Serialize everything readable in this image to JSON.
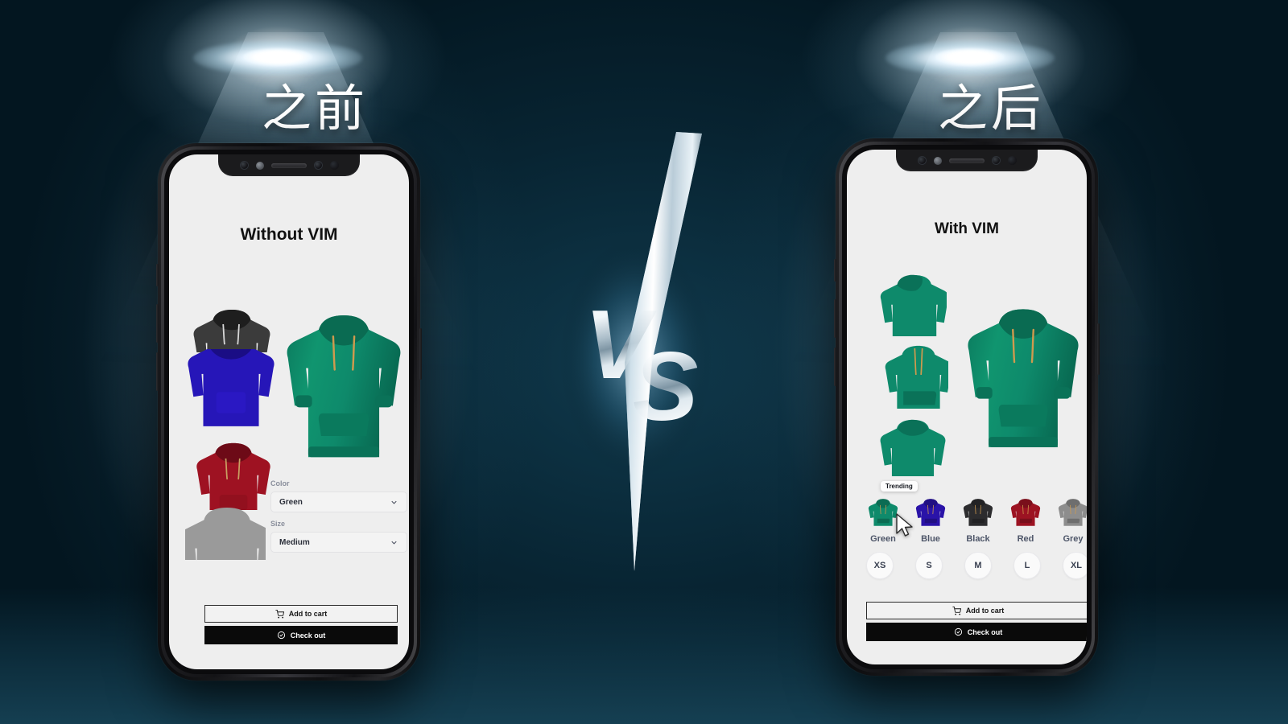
{
  "background": {
    "base_color": "#05202c",
    "accent_color": "#0f8f6d"
  },
  "comparison": {
    "left_label": "之前",
    "right_label": "之后",
    "divider_text": "VS"
  },
  "left_phone": {
    "app_title": "Without VIM",
    "color_field": {
      "label": "Color",
      "value": "Green",
      "chevron": "chevron-down-icon"
    },
    "size_field": {
      "label": "Size",
      "value": "Medium",
      "chevron": "chevron-down-icon"
    },
    "add_to_cart": {
      "label": "Add to cart",
      "icon": "shopping-cart-icon"
    },
    "check_out": {
      "label": "Check out",
      "icon": "check-circle-icon"
    },
    "thumbnails": [
      {
        "name": "black-hoodie-thumbnail",
        "color": "#3b3b3b"
      },
      {
        "name": "blue-hoodie-thumbnail",
        "color": "#2616b8"
      },
      {
        "name": "red-hoodie-thumbnail",
        "color": "#9e1222"
      },
      {
        "name": "grey-hoodie-thumbnail",
        "color": "#9a9a9a"
      }
    ],
    "hero": {
      "name": "green-hoodie-hero",
      "color": "#0e8a6b"
    }
  },
  "right_phone": {
    "app_title": "With VIM",
    "badge": "Trending",
    "cursor": "mouse-pointer-icon",
    "thumbnails": [
      {
        "name": "green-hoodie-back-thumbnail",
        "color": "#0e8a6b"
      },
      {
        "name": "green-hoodie-side-thumbnail",
        "color": "#0e8a6b"
      },
      {
        "name": "green-hoodie-front-thumbnail",
        "color": "#0e8a6b"
      }
    ],
    "hero": {
      "name": "green-hoodie-hero",
      "color": "#0e8a6b"
    },
    "colors": [
      {
        "label": "Green",
        "hex": "#0e8a6b"
      },
      {
        "label": "Blue",
        "hex": "#2a13a8"
      },
      {
        "label": "Black",
        "hex": "#2c2c2e"
      },
      {
        "label": "Red",
        "hex": "#9c1322"
      },
      {
        "label": "Grey",
        "hex": "#8d8d8d"
      }
    ],
    "sizes": [
      "XS",
      "S",
      "M",
      "L",
      "XL"
    ],
    "add_to_cart": {
      "label": "Add to cart",
      "icon": "shopping-cart-icon"
    },
    "check_out": {
      "label": "Check out",
      "icon": "check-circle-icon"
    }
  }
}
